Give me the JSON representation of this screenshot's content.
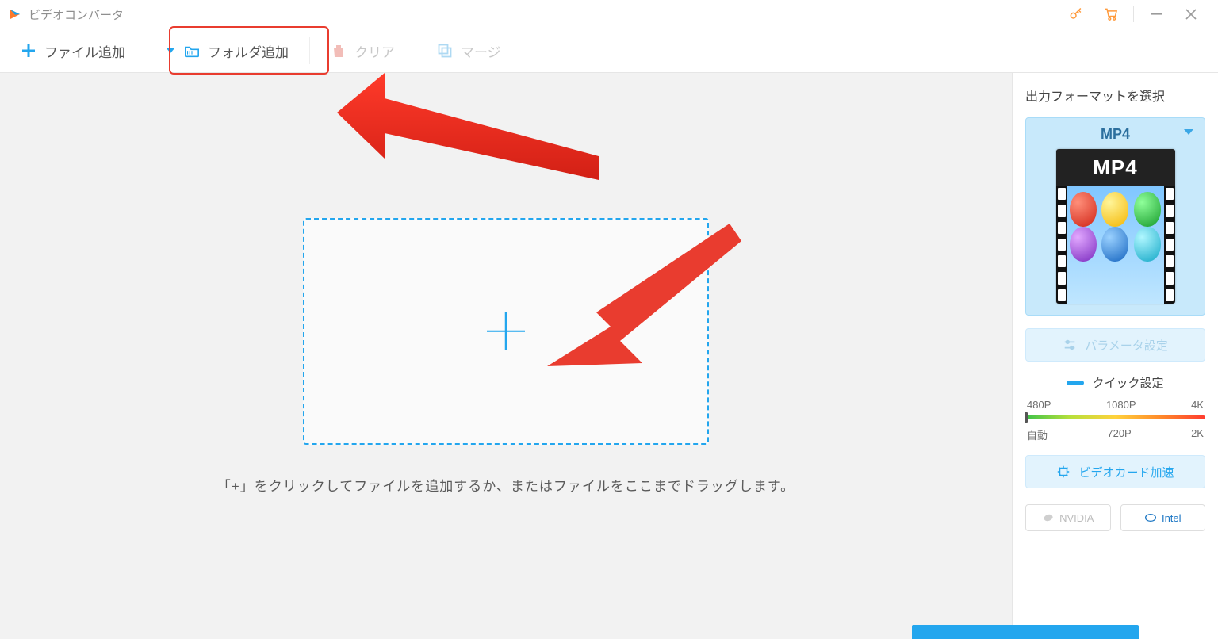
{
  "app": {
    "title": "ビデオコンバータ"
  },
  "toolbar": {
    "add_file": "ファイル追加",
    "add_folder": "フォルダ追加",
    "clear": "クリア",
    "merge": "マージ"
  },
  "workspace": {
    "hint": "「+」をクリックしてファイルを追加するか、またはファイルをここまでドラッグします。"
  },
  "sidepanel": {
    "title": "出力フォーマットを選択",
    "selected_format": "MP4",
    "thumb_badge": "MP4",
    "param_settings": "パラメータ設定",
    "quick_settings": "クイック設定",
    "preset_top": [
      "480P",
      "1080P",
      "4K"
    ],
    "preset_bottom": [
      "自動",
      "720P",
      "2K"
    ],
    "gpu_accel": "ビデオカード加速",
    "gpus": {
      "nvidia": "NVIDIA",
      "intel": "Intel"
    }
  }
}
